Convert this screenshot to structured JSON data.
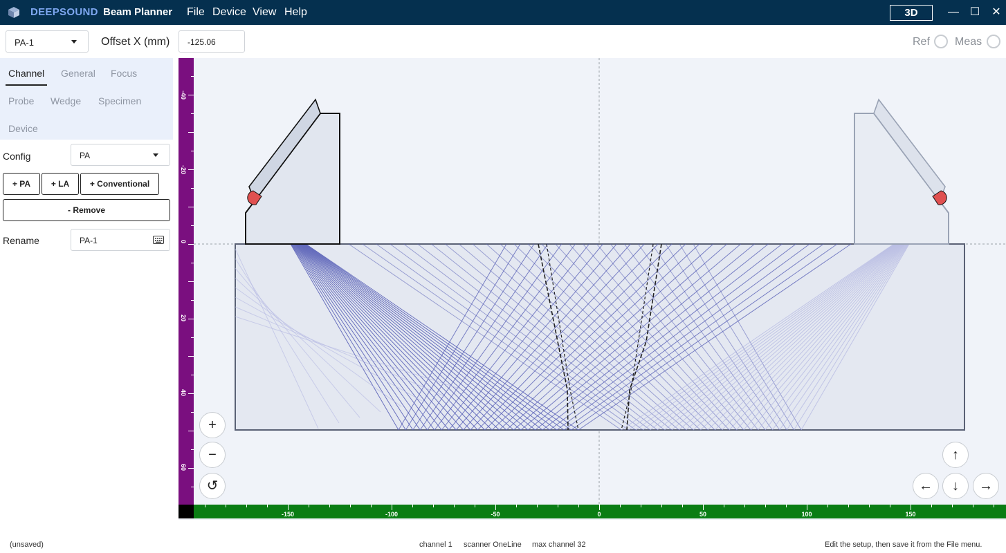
{
  "titlebar": {
    "brand": "DEEPSOUND",
    "app_title": "Beam Planner",
    "menus": [
      "File",
      "Device",
      "View",
      "Help"
    ],
    "mode_button": "3D",
    "minimize_glyph": "—",
    "maximize_glyph": "☐",
    "close_glyph": "✕"
  },
  "toolbar": {
    "channel_value": "PA-1",
    "offset_label": "Offset X (mm)",
    "offset_value": "-125.06",
    "ref_label": "Ref",
    "meas_label": "Meas"
  },
  "sidebar": {
    "tabs": [
      {
        "label": "Channel",
        "active": true
      },
      {
        "label": "General",
        "active": false
      },
      {
        "label": "Focus",
        "active": false
      },
      {
        "label": "Probe",
        "active": false
      },
      {
        "label": "Wedge",
        "active": false
      },
      {
        "label": "Specimen",
        "active": false
      },
      {
        "label": "Device",
        "active": false
      }
    ],
    "config_label": "Config",
    "config_value": "PA",
    "add_pa": "+ PA",
    "add_la": "+ LA",
    "add_conventional": "+ Conventional",
    "remove": "- Remove",
    "rename_label": "Rename",
    "rename_value": "PA-1"
  },
  "canvas": {
    "h_ruler_labels": [
      "-150",
      "-100",
      "-50",
      "0",
      "50",
      "100",
      "150"
    ],
    "v_ruler_labels": [
      "-40",
      "-20",
      "0",
      "20",
      "40",
      "60"
    ],
    "zoom_in": "+",
    "zoom_out": "−",
    "reset": "↺",
    "pan_up": "↑",
    "pan_down": "↓",
    "pan_left": "←",
    "pan_right": "→"
  },
  "colors": {
    "titlebar": "#05304f",
    "brand": "#7ea7f0",
    "beam": "#5b63b8",
    "beam_faded": "#b4b8e2",
    "specimen_fill": "#e4e8f1",
    "wedge_fill": "#e1e6ef",
    "element": "#e05050",
    "v_ruler": "#7a0f7f",
    "h_ruler": "#0a7d14"
  },
  "status": {
    "saved_state": "(unsaved)",
    "channel": "channel 1",
    "scanner": "scanner OneLine",
    "max_channel": "max channel 32",
    "hint": "Edit the setup, then save it from the File menu."
  }
}
